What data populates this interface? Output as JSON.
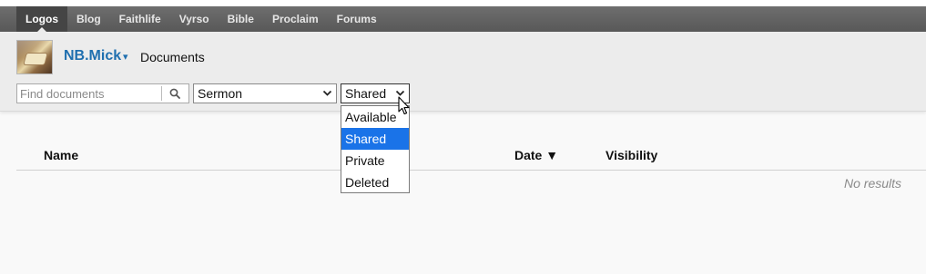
{
  "nav": {
    "items": [
      {
        "label": "Logos",
        "active": true
      },
      {
        "label": "Blog"
      },
      {
        "label": "Faithlife"
      },
      {
        "label": "Vyrso"
      },
      {
        "label": "Bible"
      },
      {
        "label": "Proclaim"
      },
      {
        "label": "Forums"
      }
    ]
  },
  "user": {
    "name": "NB.Mick",
    "caret": "▾"
  },
  "page": {
    "title": "Documents"
  },
  "search": {
    "placeholder": "Find documents",
    "value": ""
  },
  "filters": {
    "type_value": "Sermon",
    "visibility_value": "Shared",
    "visibility_options": [
      "Available",
      "Shared",
      "Private",
      "Deleted"
    ],
    "visibility_selected": "Shared"
  },
  "table": {
    "columns": {
      "name": "Name",
      "date": "Date ▼",
      "visibility": "Visibility"
    },
    "empty_text": "No results"
  },
  "colors": {
    "accent": "#1f6faf",
    "selection": "#1a73e8",
    "navbar": "#5f5f5f"
  }
}
